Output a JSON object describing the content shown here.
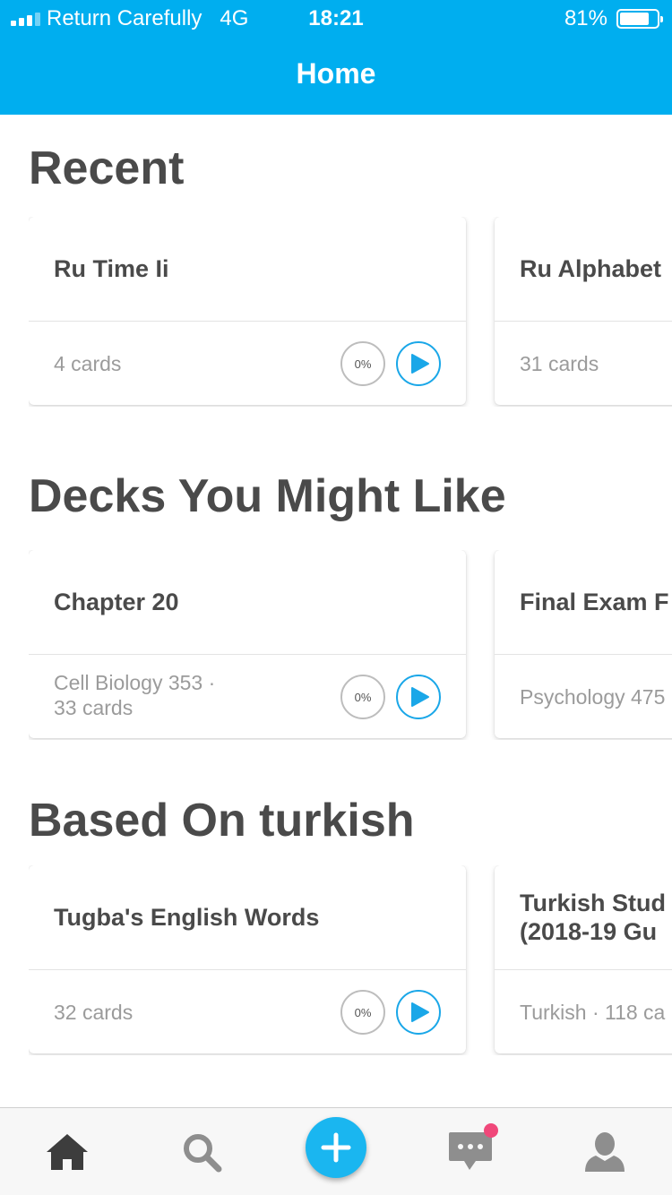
{
  "status_bar": {
    "carrier": "Return Carefully",
    "network": "4G",
    "time": "18:21",
    "battery": "81%",
    "battery_level": 0.81
  },
  "header": {
    "title": "Home"
  },
  "colors": {
    "accent": "#00aeef",
    "play": "#1aa7e8",
    "badge": "#f0487a"
  },
  "sections": [
    {
      "title": "Recent",
      "cards": [
        {
          "title": "Ru Time Ii",
          "meta": "4 cards",
          "progress": "0%"
        },
        {
          "title": "Ru Alphabet",
          "meta": "31 cards"
        }
      ]
    },
    {
      "title": "Decks You Might Like",
      "cards": [
        {
          "title": "Chapter 20",
          "meta": "Cell Biology 353 ·\n33 cards",
          "progress": "0%"
        },
        {
          "title": "Final Exam F",
          "meta": "Psychology 475"
        }
      ]
    },
    {
      "title": "Based On turkish",
      "cards": [
        {
          "title": "Tugba's English Words",
          "meta": "32 cards",
          "progress": "0%"
        },
        {
          "title": "Turkish Stud\n(2018-19 Gu",
          "meta": "Turkish · 118 ca"
        }
      ]
    }
  ],
  "tabbar": {
    "items": [
      "home-icon",
      "search-icon",
      "add-icon",
      "messages-icon",
      "profile-icon"
    ]
  }
}
